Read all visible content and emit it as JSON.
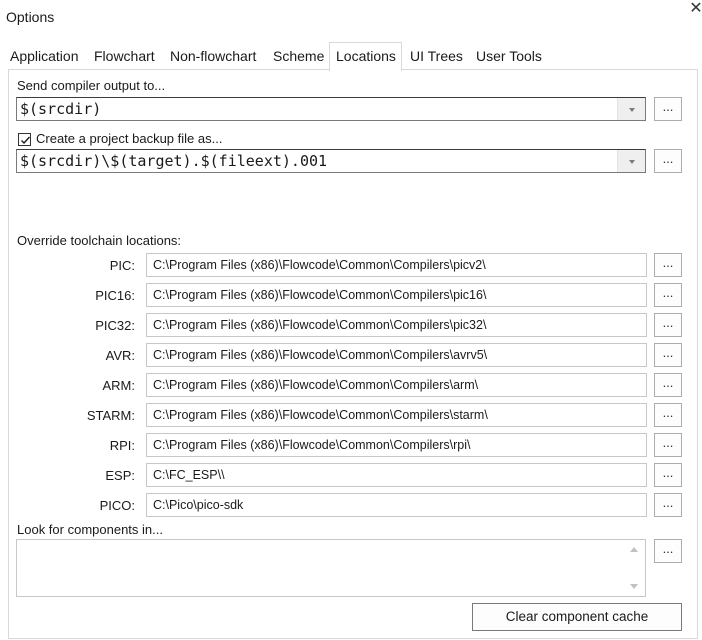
{
  "window": {
    "title": "Options",
    "close_symbol": "✕"
  },
  "tabs": [
    {
      "label": "Application"
    },
    {
      "label": "Flowchart"
    },
    {
      "label": "Non-flowchart"
    },
    {
      "label": "Scheme"
    },
    {
      "label": "Locations",
      "active": true
    },
    {
      "label": "UI Trees"
    },
    {
      "label": "User Tools"
    }
  ],
  "compiler_output": {
    "label": "Send compiler output to...",
    "value": "$(srcdir)",
    "browse": "..."
  },
  "backup": {
    "label": "Create a project backup file as...",
    "checked": true,
    "value": "$(srcdir)\\$(target).$(fileext).001",
    "browse": "..."
  },
  "toolchain": {
    "label": "Override toolchain locations:",
    "rows": [
      {
        "name": "PIC:",
        "path": "C:\\Program Files (x86)\\Flowcode\\Common\\Compilers\\picv2\\",
        "browse": "..."
      },
      {
        "name": "PIC16:",
        "path": "C:\\Program Files (x86)\\Flowcode\\Common\\Compilers\\pic16\\",
        "browse": "..."
      },
      {
        "name": "PIC32:",
        "path": "C:\\Program Files (x86)\\Flowcode\\Common\\Compilers\\pic32\\",
        "browse": "..."
      },
      {
        "name": "AVR:",
        "path": "C:\\Program Files (x86)\\Flowcode\\Common\\Compilers\\avrv5\\",
        "browse": "..."
      },
      {
        "name": "ARM:",
        "path": "C:\\Program Files (x86)\\Flowcode\\Common\\Compilers\\arm\\",
        "browse": "..."
      },
      {
        "name": "STARM:",
        "path": "C:\\Program Files (x86)\\Flowcode\\Common\\Compilers\\starm\\",
        "browse": "..."
      },
      {
        "name": "RPI:",
        "path": "C:\\Program Files (x86)\\Flowcode\\Common\\Compilers\\rpi\\",
        "browse": "..."
      },
      {
        "name": "ESP:",
        "path": "C:\\FC_ESP\\\\",
        "browse": "..."
      },
      {
        "name": "PICO:",
        "path": "C:\\Pico\\pico-sdk",
        "browse": "..."
      }
    ]
  },
  "components": {
    "label": "Look for components in...",
    "browse": "..."
  },
  "clear_cache": {
    "label": "Clear component cache"
  },
  "icons": {
    "close": "close-icon",
    "checkbox": "check-icon",
    "dropdown": "chevron-down-icon",
    "scroll_up": "scroll-up-icon",
    "scroll_down": "scroll-down-icon"
  }
}
